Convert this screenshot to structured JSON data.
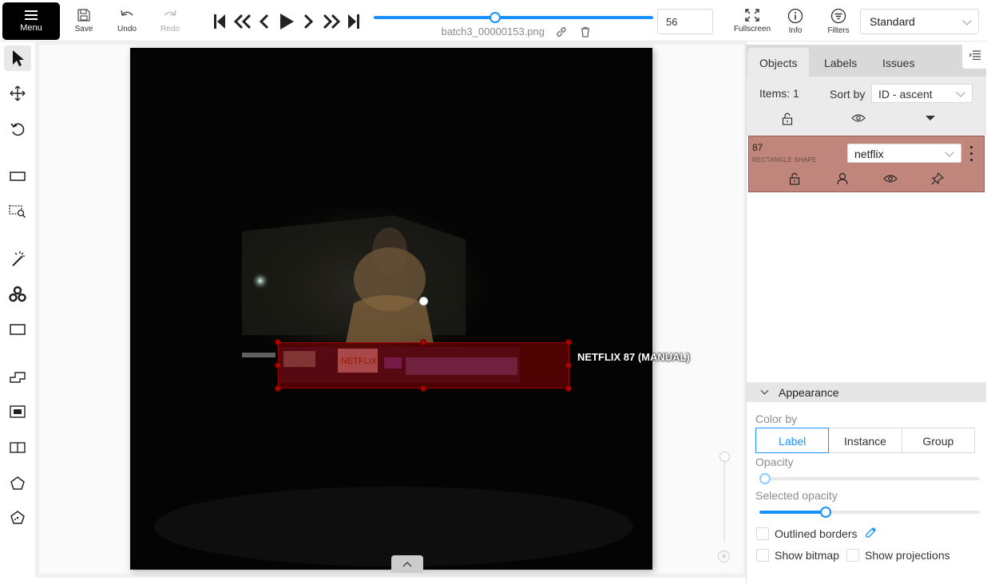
{
  "toolbar": {
    "menu_label": "Menu",
    "save_label": "Save",
    "undo_label": "Undo",
    "redo_label": "Redo",
    "fullscreen_label": "Fullscreen",
    "info_label": "Info",
    "filters_label": "Filters",
    "view_mode": "Standard",
    "frame_number": "56",
    "filename": "batch3_00000153.png",
    "frame_progress": 0.43
  },
  "left_tools": [
    "cursor-icon",
    "move-icon",
    "rotate-icon",
    "fit-image-icon",
    "zoom-region-icon",
    "magic-wand-icon",
    "opencv-icon",
    "rectangle-icon",
    "polygon-icon",
    "cuboid-icon",
    "tag-icon",
    "merge-icon",
    "group-icon",
    "split-icon"
  ],
  "canvas": {
    "annotation_label": "NETFLIX 87 (MANUAL)",
    "annotation_color": "#8c0000"
  },
  "sidebar": {
    "tabs": [
      "Objects",
      "Labels",
      "Issues"
    ],
    "active_tab": "Objects",
    "items_count": "Items: 1",
    "sort_by_label": "Sort by",
    "sort_value": "ID - ascent",
    "object": {
      "id": "87",
      "type": "RECTANGLE SHAPE",
      "label": "netflix",
      "color": "#c0867c"
    }
  },
  "appearance": {
    "title": "Appearance",
    "color_by_label": "Color by",
    "color_by_options": [
      "Label",
      "Instance",
      "Group"
    ],
    "color_by_selected": "Label",
    "opacity_label": "Opacity",
    "opacity_value": 0.03,
    "selected_opacity_label": "Selected opacity",
    "selected_opacity_value": 0.3,
    "outlined_borders_label": "Outlined borders",
    "show_bitmap_label": "Show bitmap",
    "show_projections_label": "Show projections",
    "accent_color": "#1890ff"
  }
}
